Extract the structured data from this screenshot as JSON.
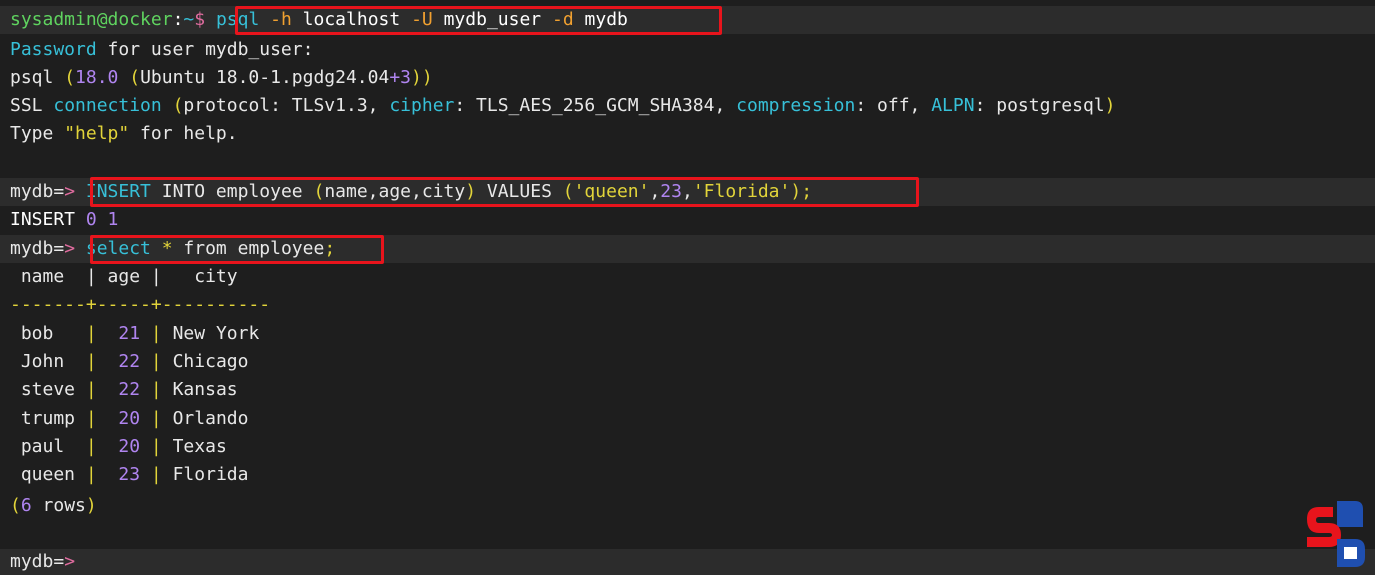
{
  "colors": {
    "background": "#1e1e1e",
    "highlight": "#2c2c2c",
    "prompt_green": "#5fd35f",
    "keyword_cyan": "#37c0d8",
    "flag_orange": "#f0a030",
    "string_yellow": "#e2d43a",
    "number_purple": "#b085f0",
    "annotation_red": "#e8141c"
  },
  "line1": {
    "user_host": "sysadmin@docker",
    "sep": ":",
    "path": "~",
    "dollar": "$",
    "cmd": "psql",
    "flag_h": "-h",
    "host": "localhost",
    "flag_U": "-U",
    "user": "mydb_user",
    "flag_d": "-d",
    "db": "mydb"
  },
  "line2": {
    "word1": "Password",
    "rest": " for user mydb_user:"
  },
  "line3": {
    "a": "psql ",
    "b": "(",
    "c": "18.0 ",
    "d": "(",
    "e": "Ubuntu 18.0-1.pgdg24.04",
    "f": "+3",
    "g": "))"
  },
  "line4": {
    "a": "SSL ",
    "b": "connection",
    "c": " ",
    "d": "(",
    "e": "protocol",
    "f": ": TLSv1.3, ",
    "g": "cipher",
    "h": ": TLS_AES_256_GCM_SHA384, ",
    "i": "compression",
    "j": ": off, ",
    "k": "ALPN",
    "l": ": postgresql",
    "m": ")"
  },
  "line5": {
    "a": "Type ",
    "b": "\"help\"",
    "c": " for help."
  },
  "insert_line": {
    "prompt": "mydb=",
    "arrow": ">",
    "kw1": "INSERT",
    "t1": " INTO employee ",
    "p1": "(",
    "cols": "name,age,city",
    "p2": ")",
    "t2": " VALUES ",
    "p3": "(",
    "s1": "'queen'",
    "comma1": ",",
    "num": "23",
    "comma2": ",",
    "s2": "'Florida'",
    "p4": ")",
    "semi": ";"
  },
  "insert_result": {
    "a": "INSERT ",
    "b": "0 1"
  },
  "select_line": {
    "prompt": "mydb=",
    "arrow": ">",
    "kw": "select",
    "star": " * ",
    "rest": "from employee",
    "semi": ";"
  },
  "table": {
    "header": " name  | age |   city",
    "separator": "-------+-----+----------",
    "rows": [
      {
        "name": " bob   ",
        "age": "21",
        "city": "New York"
      },
      {
        "name": " John  ",
        "age": "22",
        "city": "Chicago"
      },
      {
        "name": " steve ",
        "age": "22",
        "city": "Kansas"
      },
      {
        "name": " trump ",
        "age": "20",
        "city": "Orlando"
      },
      {
        "name": " paul  ",
        "age": "20",
        "city": "Texas"
      },
      {
        "name": " queen ",
        "age": "23",
        "city": "Florida"
      }
    ],
    "count_open": "(",
    "count_num": "6",
    "count_text": " rows",
    "count_close": ")"
  },
  "final_prompt": {
    "prompt": "mydb=",
    "arrow": ">"
  },
  "logo": {
    "icon": "sb-logo-icon"
  }
}
